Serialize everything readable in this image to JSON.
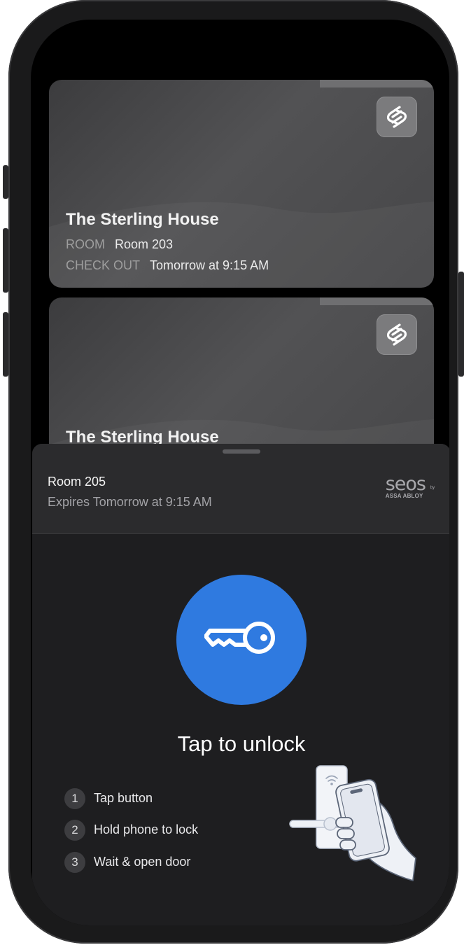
{
  "passes": [
    {
      "hotel": "The Sterling House",
      "room_key": "ROOM",
      "room_value": "Room 203",
      "checkout_key": "CHECK OUT",
      "checkout_value": "Tomorrow at 9:15 AM",
      "logo_icon": "hotel-brand-icon"
    },
    {
      "hotel": "The Sterling House",
      "logo_icon": "hotel-brand-icon"
    }
  ],
  "sheet": {
    "room": "Room 205",
    "expires": "Expires Tomorrow at 9:15 AM",
    "brand": {
      "name": "seos",
      "by": "by",
      "sub": "ASSA ABLOY"
    },
    "unlock_icon": "key-icon",
    "unlock_color": "#2f7ae0",
    "unlock_label": "Tap to unlock",
    "steps": [
      {
        "num": "1",
        "text": "Tap button"
      },
      {
        "num": "2",
        "text": "Hold phone to lock"
      },
      {
        "num": "3",
        "text": "Wait & open door"
      }
    ],
    "illustration": "hand-holding-phone-to-lock-illustration"
  }
}
